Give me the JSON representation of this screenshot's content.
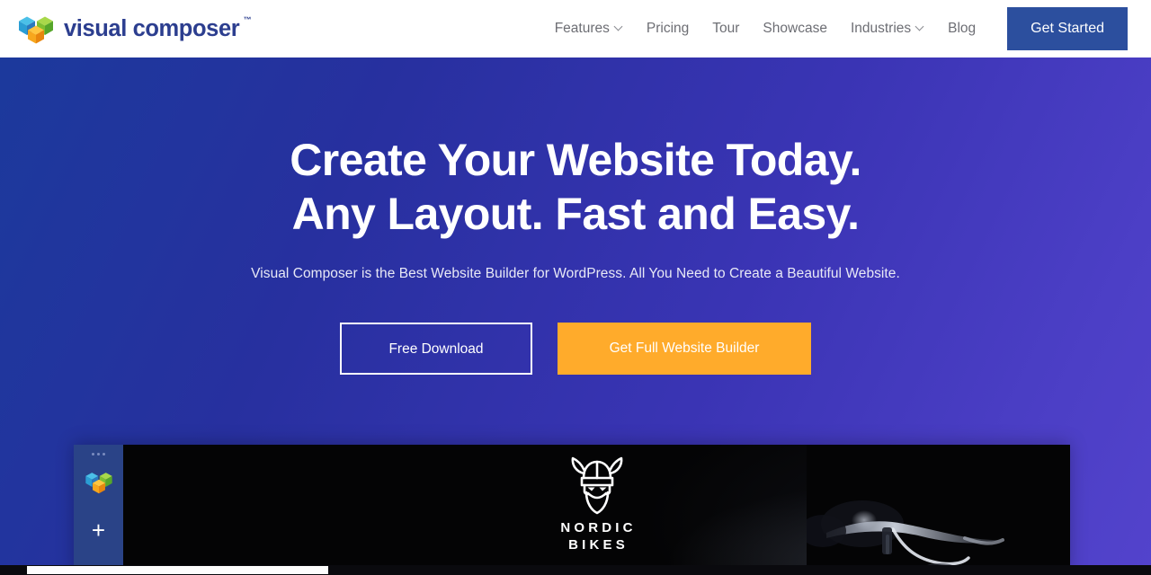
{
  "header": {
    "logo": {
      "icon": "visual-composer-cubes-logo",
      "wordmark": "visual composer",
      "trademark": "™"
    },
    "nav": [
      {
        "label": "Features",
        "has_dropdown": true,
        "icon": "chevron-down-icon"
      },
      {
        "label": "Pricing",
        "has_dropdown": false,
        "icon": ""
      },
      {
        "label": "Tour",
        "has_dropdown": false,
        "icon": ""
      },
      {
        "label": "Showcase",
        "has_dropdown": false,
        "icon": ""
      },
      {
        "label": "Industries",
        "has_dropdown": true,
        "icon": "chevron-down-icon"
      },
      {
        "label": "Blog",
        "has_dropdown": false,
        "icon": ""
      }
    ],
    "cta_label": "Get Started",
    "cta_color": "#2c4f9e",
    "background": "#ffffff",
    "nav_text_color": "#6d6e74"
  },
  "hero": {
    "headline_line1": "Create Your Website Today.",
    "headline_line2": "Any Layout. Fast and Easy.",
    "subheadline": "Visual Composer is the Best Website Builder for WordPress. All You Need to Create a Beautiful Website.",
    "buttons": {
      "secondary_label": "Free Download",
      "primary_label": "Get Full Website Builder",
      "primary_color": "#ffab2b",
      "secondary_border_color": "#ffffff"
    },
    "background_gradient_start": "#1b3a9c",
    "background_gradient_end": "#5343cc",
    "text_color": "#ffffff"
  },
  "preview": {
    "sidebar": {
      "dots_icon": "window-dots-icon",
      "logo_icon": "visual-composer-cubes-logo",
      "add_label": "+",
      "background": "#2a4387"
    },
    "canvas": {
      "brand_icon": "viking-head-icon",
      "brand_line1": "NORDIC",
      "brand_line2": "BIKES",
      "photo_icon": "bicycle-handlebar-photo",
      "background": "#040405"
    }
  },
  "scrollbar": {
    "orientation": "horizontal",
    "thumb_color": "#fdfdfd",
    "track_color": "#0a0a0e"
  }
}
